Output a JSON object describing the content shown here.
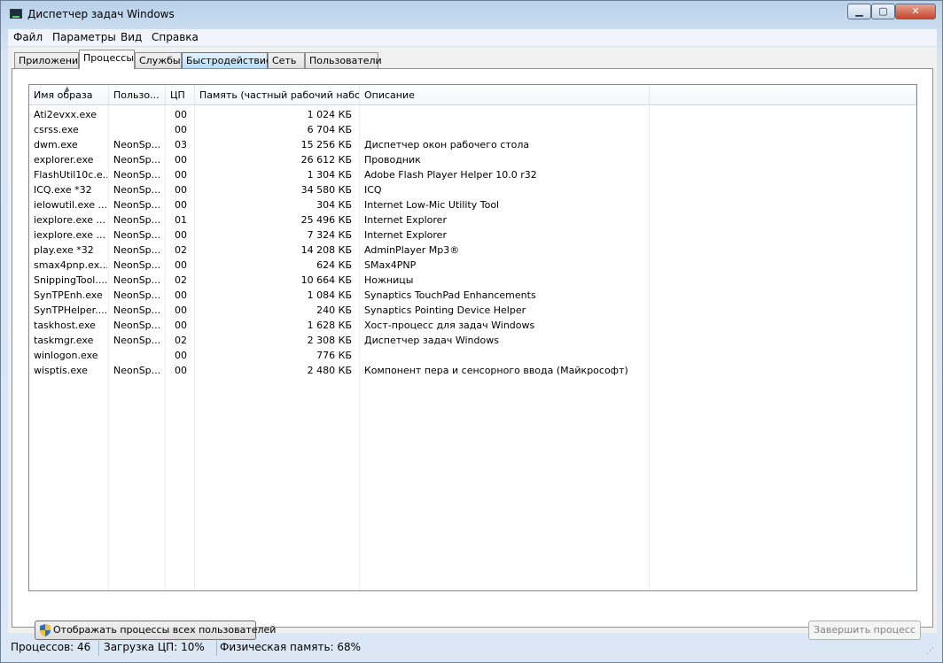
{
  "window": {
    "title": "Диспетчер задач Windows",
    "min_label": "▁",
    "max_label": "▢",
    "close_label": "✕"
  },
  "menu": [
    "Файл",
    "Параметры",
    "Вид",
    "Справка"
  ],
  "tabs": [
    {
      "label": "Приложения",
      "state": "normal"
    },
    {
      "label": "Процессы",
      "state": "active"
    },
    {
      "label": "Службы",
      "state": "normal"
    },
    {
      "label": "Быстродействие",
      "state": "hover"
    },
    {
      "label": "Сеть",
      "state": "normal"
    },
    {
      "label": "Пользователи",
      "state": "normal"
    }
  ],
  "columns": {
    "name": "Имя образа",
    "user": "Пользо...",
    "cpu": "ЦП",
    "memory": "Память (частный рабочий набор)",
    "description": "Описание"
  },
  "processes": [
    {
      "name": "Ati2evxx.exe",
      "user": "",
      "cpu": "00",
      "memory": "1 024 КБ",
      "description": ""
    },
    {
      "name": "csrss.exe",
      "user": "",
      "cpu": "00",
      "memory": "6 704 КБ",
      "description": ""
    },
    {
      "name": "dwm.exe",
      "user": "NeonSp...",
      "cpu": "03",
      "memory": "15 256 КБ",
      "description": "Диспетчер окон рабочего стола"
    },
    {
      "name": "explorer.exe",
      "user": "NeonSp...",
      "cpu": "00",
      "memory": "26 612 КБ",
      "description": "Проводник"
    },
    {
      "name": "FlashUtil10c.e...",
      "user": "NeonSp...",
      "cpu": "00",
      "memory": "1 304 КБ",
      "description": "Adobe Flash Player Helper 10.0 r32"
    },
    {
      "name": "ICQ.exe *32",
      "user": "NeonSp...",
      "cpu": "00",
      "memory": "34 580 КБ",
      "description": "ICQ"
    },
    {
      "name": "ielowutil.exe ...",
      "user": "NeonSp...",
      "cpu": "00",
      "memory": "304 КБ",
      "description": "Internet Low-Mic Utility Tool"
    },
    {
      "name": "iexplore.exe ...",
      "user": "NeonSp...",
      "cpu": "01",
      "memory": "25 496 КБ",
      "description": "Internet Explorer"
    },
    {
      "name": "iexplore.exe ...",
      "user": "NeonSp...",
      "cpu": "00",
      "memory": "7 324 КБ",
      "description": "Internet Explorer"
    },
    {
      "name": "play.exe *32",
      "user": "NeonSp...",
      "cpu": "02",
      "memory": "14 208 КБ",
      "description": "AdminPlayer Mp3®"
    },
    {
      "name": "smax4pnp.ex...",
      "user": "NeonSp...",
      "cpu": "00",
      "memory": "624 КБ",
      "description": "SMax4PNP"
    },
    {
      "name": "SnippingTool....",
      "user": "NeonSp...",
      "cpu": "02",
      "memory": "10 664 КБ",
      "description": "Ножницы"
    },
    {
      "name": "SynTPEnh.exe",
      "user": "NeonSp...",
      "cpu": "00",
      "memory": "1 084 КБ",
      "description": "Synaptics TouchPad Enhancements"
    },
    {
      "name": "SynTPHelper....",
      "user": "NeonSp...",
      "cpu": "00",
      "memory": "240 КБ",
      "description": "Synaptics Pointing Device Helper"
    },
    {
      "name": "taskhost.exe",
      "user": "NeonSp...",
      "cpu": "00",
      "memory": "1 628 КБ",
      "description": "Хост-процесс для задач Windows"
    },
    {
      "name": "taskmgr.exe",
      "user": "NeonSp...",
      "cpu": "02",
      "memory": "2 308 КБ",
      "description": "Диспетчер задач Windows"
    },
    {
      "name": "winlogon.exe",
      "user": "",
      "cpu": "00",
      "memory": "776 КБ",
      "description": ""
    },
    {
      "name": "wisptis.exe",
      "user": "NeonSp...",
      "cpu": "00",
      "memory": "2 480 КБ",
      "description": "Компонент пера и сенсорного ввода (Майкрософт)"
    }
  ],
  "buttons": {
    "show_all": "Отображать процессы всех пользователей",
    "end_process": "Завершить процесс"
  },
  "status": {
    "processes": "Процессов: 46",
    "cpu": "Загрузка ЦП: 10%",
    "memory": "Физическая память: 68%"
  },
  "colors": {
    "title_gradient": "#b9d1ea",
    "tab_hover": "#b9ddf5",
    "close_button": "#c4452c"
  }
}
